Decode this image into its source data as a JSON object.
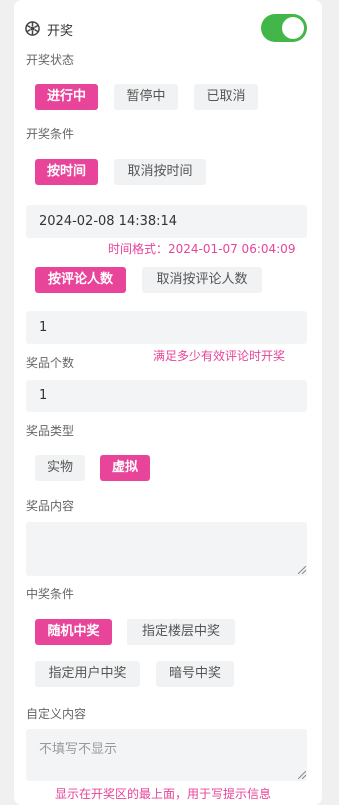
{
  "header": {
    "title": "开奖",
    "enabled": true
  },
  "status": {
    "label": "开奖状态",
    "options": [
      "进行中",
      "暂停中",
      "已取消"
    ],
    "selected": "进行中"
  },
  "condition": {
    "label": "开奖条件",
    "time_on": "按时间",
    "time_off": "取消按时间",
    "time_value": "2024-02-08 14:38:14",
    "time_hint": "时间格式：2024-01-07 06:04:09",
    "comment_on": "按评论人数",
    "comment_off": "取消按评论人数",
    "comment_value": "1",
    "comment_hint": "满足多少有效评论时开奖"
  },
  "prize_count": {
    "label": "奖品个数",
    "value": "1"
  },
  "prize_type": {
    "label": "奖品类型",
    "options": [
      "实物",
      "虚拟"
    ],
    "selected": "虚拟"
  },
  "prize_content": {
    "label": "奖品内容",
    "value": ""
  },
  "win_condition": {
    "label": "中奖条件",
    "options": [
      "随机中奖",
      "指定楼层中奖",
      "指定用户中奖",
      "暗号中奖"
    ],
    "selected": "随机中奖"
  },
  "custom": {
    "label": "自定义内容",
    "placeholder": "不填写不显示",
    "hint": "显示在开奖区的最上面，用于写提示信息"
  },
  "colors": {
    "accent": "#e8449a",
    "toggle_on": "#43b649",
    "field_bg": "#f3f4f6"
  },
  "icons": {
    "header": "aperture-icon"
  }
}
